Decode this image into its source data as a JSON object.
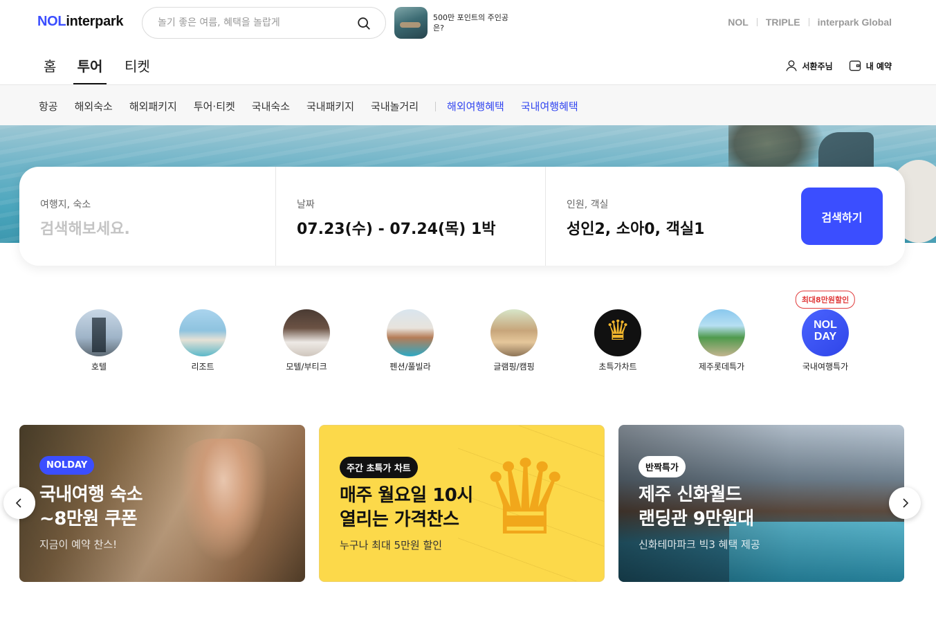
{
  "header": {
    "logo_nol": "NOL",
    "logo_brand": "interpark",
    "search_placeholder": "놀기 좋은 여름, 혜택을 놀랍게",
    "promo_text": "500만 포인트의 주인공은?",
    "brands": [
      "NOL",
      "TRIPLE",
      "interpark Global"
    ]
  },
  "main_nav": {
    "tabs": [
      {
        "label": "홈",
        "active": false
      },
      {
        "label": "투어",
        "active": true
      },
      {
        "label": "티켓",
        "active": false
      }
    ],
    "user_label": "서환주님",
    "reservation_label": "내 예약"
  },
  "sub_nav": {
    "items": [
      "항공",
      "해외숙소",
      "해외패키지",
      "투어·티켓",
      "국내숙소",
      "국내패키지",
      "국내놀거리"
    ],
    "highlight_items": [
      "해외여행혜택",
      "국내여행혜택"
    ]
  },
  "search_card": {
    "destination_label": "여행지, 숙소",
    "destination_placeholder": "검색해보세요.",
    "date_label": "날짜",
    "date_value": "07.23(수) - 07.24(목) 1박",
    "guests_label": "인원, 객실",
    "guests_value": "성인2, 소아0, 객실1",
    "search_button": "검색하기"
  },
  "categories": [
    {
      "label": "호텔",
      "icon": "hotel-icon"
    },
    {
      "label": "리조트",
      "icon": "resort-icon"
    },
    {
      "label": "모텔/부티크",
      "icon": "motel-icon"
    },
    {
      "label": "펜션/풀빌라",
      "icon": "pension-icon"
    },
    {
      "label": "글램핑/캠핑",
      "icon": "glamping-icon"
    },
    {
      "label": "초특가차트",
      "icon": "crown-icon"
    },
    {
      "label": "제주롯데특가",
      "icon": "jeju-icon"
    },
    {
      "label": "국내여행특가",
      "icon": "nolday-icon",
      "badge": "최대8만원할인",
      "logo_text": "NOL DAY"
    }
  ],
  "banners": [
    {
      "tag": "NOLDAY",
      "title_line1": "국내여행 숙소",
      "title_line2": "~8만원 쿠폰",
      "subtitle": "지금이 예약 찬스!"
    },
    {
      "tag": "주간 초특가 차트",
      "title_line1": "매주 월요일 10시",
      "title_line2": "열리는 가격찬스",
      "subtitle": "누구나 최대 5만원 할인"
    },
    {
      "tag": "반짝특가",
      "title_line1": "제주 신화월드",
      "title_line2": "랜딩관 9만원대",
      "subtitle": "신화테마파크 빅3 혜택 제공"
    }
  ],
  "colors": {
    "brand_blue": "#3b4eff",
    "link_blue": "#3044f0",
    "badge_red": "#e03a3a",
    "banner_yellow": "#fcd94a"
  }
}
